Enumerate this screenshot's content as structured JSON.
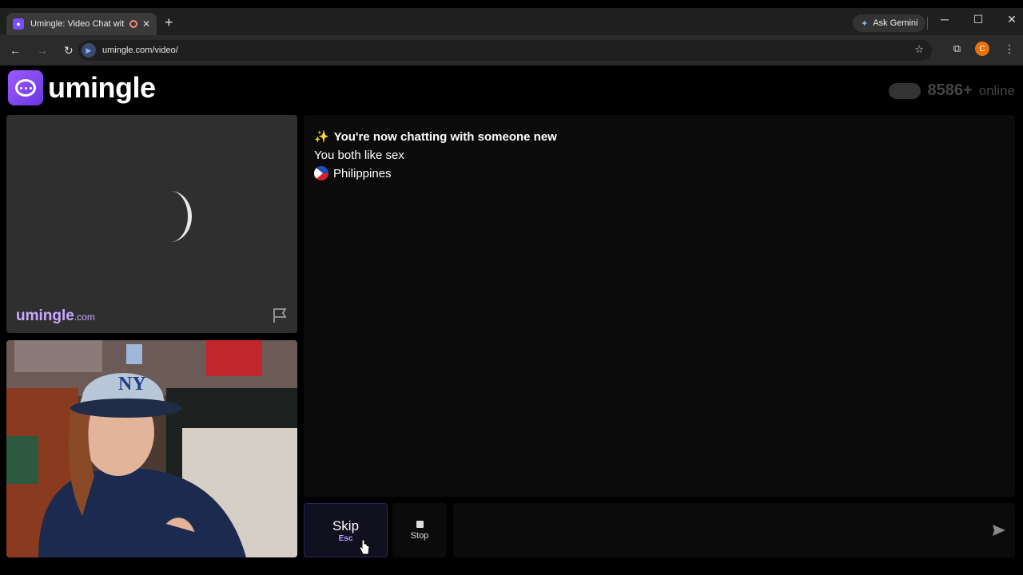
{
  "browser": {
    "tab_title": "Umingle: Video Chat with S",
    "new_tab_glyph": "+",
    "ask_gemini": "Ask Gemini",
    "url": "umingle.com/video/",
    "profile_initial": "C"
  },
  "header": {
    "logo_text": "umingle",
    "online_count": "8586+",
    "online_suffix": "online"
  },
  "stranger": {
    "watermark_main": "umingle",
    "watermark_tld": ".com"
  },
  "chat": {
    "line1": "You're now chatting with someone new",
    "line2": "You both like sex",
    "country": "Philippines"
  },
  "controls": {
    "skip_label": "Skip",
    "skip_key": "Esc",
    "stop_label": "Stop",
    "message_placeholder": ""
  },
  "colors": {
    "brand": "#7a4dff",
    "skip_border": "#2c2660"
  }
}
